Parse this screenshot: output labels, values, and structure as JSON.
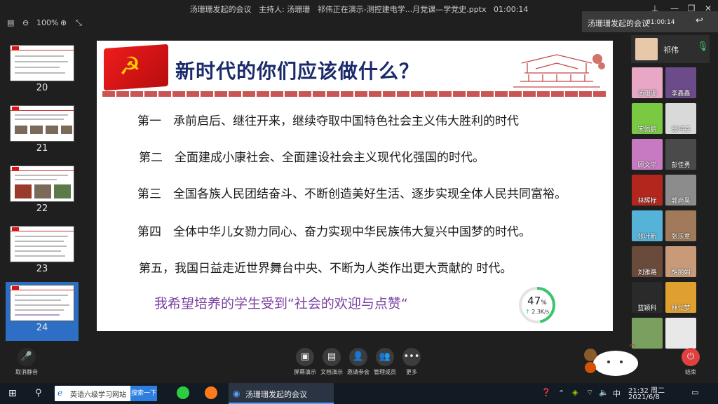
{
  "window": {
    "title": "汤珊珊发起的会议",
    "host_label": "主持人: 汤珊珊",
    "presenting": "祁伟正在演示-测控建电学...月党课—学党史.pptx",
    "elapsed": "01:00:14"
  },
  "toolbar": {
    "zoom": "100%"
  },
  "thumbnails": [
    {
      "num": "20"
    },
    {
      "num": "21"
    },
    {
      "num": "22"
    },
    {
      "num": "23"
    },
    {
      "num": "24"
    }
  ],
  "slide": {
    "title": "新时代的你们应该做什么？",
    "lines": [
      "第一　承前启后、继往开来，继续夺取中国特色社会主义伟大胜利的时代",
      "第二　全面建成小康社会、全面建设社会主义现代化强国的时代。",
      "第三　全国各族人民团结奋斗、不断创造美好生活、逐步实现全体人民共同富裕。",
      "第四　全体中华儿女勠力同心、奋力实现中华民族伟大复兴中国梦的时代。",
      "第五，我国日益走近世界舞台中央、不断为人类作出更大贡献的 时代。"
    ],
    "hope": "我希望培养的学生受到“社会的欢迎与点赞“"
  },
  "net_gauge": {
    "percent": 47,
    "percent_label": "47",
    "percent_sign": "%",
    "speed": "2.3K/s",
    "color": "#3ec46d"
  },
  "meeting_popup": {
    "title": "汤珊珊发起的会议",
    "time": "01:00:14"
  },
  "host_tile": {
    "name": "祁伟"
  },
  "participants": [
    {
      "name": "汤珊珊",
      "color": "#e8a7c4"
    },
    {
      "name": "李鑫鑫",
      "color": "#6b4b8a"
    },
    {
      "name": "宋佩鹏",
      "color": "#7ac943"
    },
    {
      "name": "翁鸿鑫",
      "color": "#d9d9d9"
    },
    {
      "name": "顾文平",
      "color": "#c77ac2"
    },
    {
      "name": "彭佳勇",
      "color": "#4a4a4a"
    },
    {
      "name": "林辉标",
      "color": "#b3261e"
    },
    {
      "name": "郭尚昊",
      "color": "#8c8c8c"
    },
    {
      "name": "张叶新",
      "color": "#55b3d9"
    },
    {
      "name": "张乐意",
      "color": "#a07a5a"
    },
    {
      "name": "刘雅路",
      "color": "#6a4a3a"
    },
    {
      "name": "胡丽娟",
      "color": "#c89a7a"
    },
    {
      "name": "蓝颖科",
      "color": "#2a2a2a"
    },
    {
      "name": "林仁梦",
      "color": "#e0a030"
    },
    {
      "name": "",
      "color": "#7aa060"
    },
    {
      "name": "",
      "color": "#e8e8e8"
    }
  ],
  "controls": {
    "mute": "取消静音",
    "screen_share": "屏幕演示",
    "doc_share": "文档演示",
    "invite": "邀请参会",
    "members": "管理成员",
    "more": "更多",
    "end": "结束"
  },
  "taskbar": {
    "ie_tab": "英语六级学习网站",
    "search": "搜索一下",
    "app": "汤珊珊发起的会议",
    "ime": "中",
    "time": "21:32 周二",
    "date": "2021/6/8"
  }
}
